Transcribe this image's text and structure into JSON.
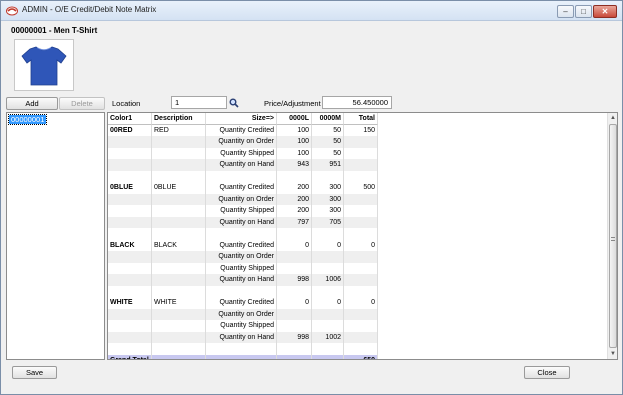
{
  "window": {
    "title": "ADMIN - O/E Credit/Debit Note Matrix",
    "minimize_glyph": "–",
    "maximize_glyph": "□",
    "close_glyph": "✕"
  },
  "item": {
    "title": "00000001 - Men T-Shirt",
    "image_icon": "tshirt-image",
    "image_color": "#2f56b8"
  },
  "toolbar": {
    "add_label": "Add",
    "delete_label": "Delete",
    "location_label": "Location",
    "location_value": "1",
    "price_label": "Price/Adjustment",
    "price_value": "56.450000"
  },
  "list": {
    "items": [
      "00000001"
    ]
  },
  "grid": {
    "headers": [
      "Color1",
      "Description",
      "Size=>",
      "0000L",
      "0000M",
      "Total"
    ],
    "rows": [
      [
        "00RED",
        "RED",
        "Quantity Credited",
        "100",
        "50",
        "150"
      ],
      [
        "",
        "",
        "Quantity on Order",
        "100",
        "50",
        ""
      ],
      [
        "",
        "",
        "Quantity Shipped",
        "100",
        "50",
        ""
      ],
      [
        "",
        "",
        "Quantity on Hand",
        "943",
        "951",
        ""
      ],
      [
        "",
        "",
        "",
        "",
        "",
        ""
      ],
      [
        "0BLUE",
        "0BLUE",
        "Quantity Credited",
        "200",
        "300",
        "500"
      ],
      [
        "",
        "",
        "Quantity on Order",
        "200",
        "300",
        ""
      ],
      [
        "",
        "",
        "Quantity Shipped",
        "200",
        "300",
        ""
      ],
      [
        "",
        "",
        "Quantity on Hand",
        "797",
        "705",
        ""
      ],
      [
        "",
        "",
        "",
        "",
        "",
        ""
      ],
      [
        "BLACK",
        "BLACK",
        "Quantity Credited",
        "0",
        "0",
        "0"
      ],
      [
        "",
        "",
        "Quantity on Order",
        "",
        "",
        ""
      ],
      [
        "",
        "",
        "Quantity Shipped",
        "",
        "",
        ""
      ],
      [
        "",
        "",
        "Quantity on Hand",
        "998",
        "1006",
        ""
      ],
      [
        "",
        "",
        "",
        "",
        "",
        ""
      ],
      [
        "WHITE",
        "WHITE",
        "Quantity Credited",
        "0",
        "0",
        "0"
      ],
      [
        "",
        "",
        "Quantity on Order",
        "",
        "",
        ""
      ],
      [
        "",
        "",
        "Quantity Shipped",
        "",
        "",
        ""
      ],
      [
        "",
        "",
        "Quantity on Hand",
        "998",
        "1002",
        ""
      ],
      [
        "",
        "",
        "",
        "",
        "",
        ""
      ]
    ],
    "grand_total_label": "Grand Total",
    "grand_total_value": "650",
    "scroll_up_glyph": "▲",
    "scroll_down_glyph": "▼"
  },
  "footer": {
    "save_label": "Save",
    "close_label": "Close"
  },
  "colors": {
    "selection": "#3399ff",
    "grand_total_row": "#c8c8f0",
    "shaded_row": "#efefef"
  }
}
